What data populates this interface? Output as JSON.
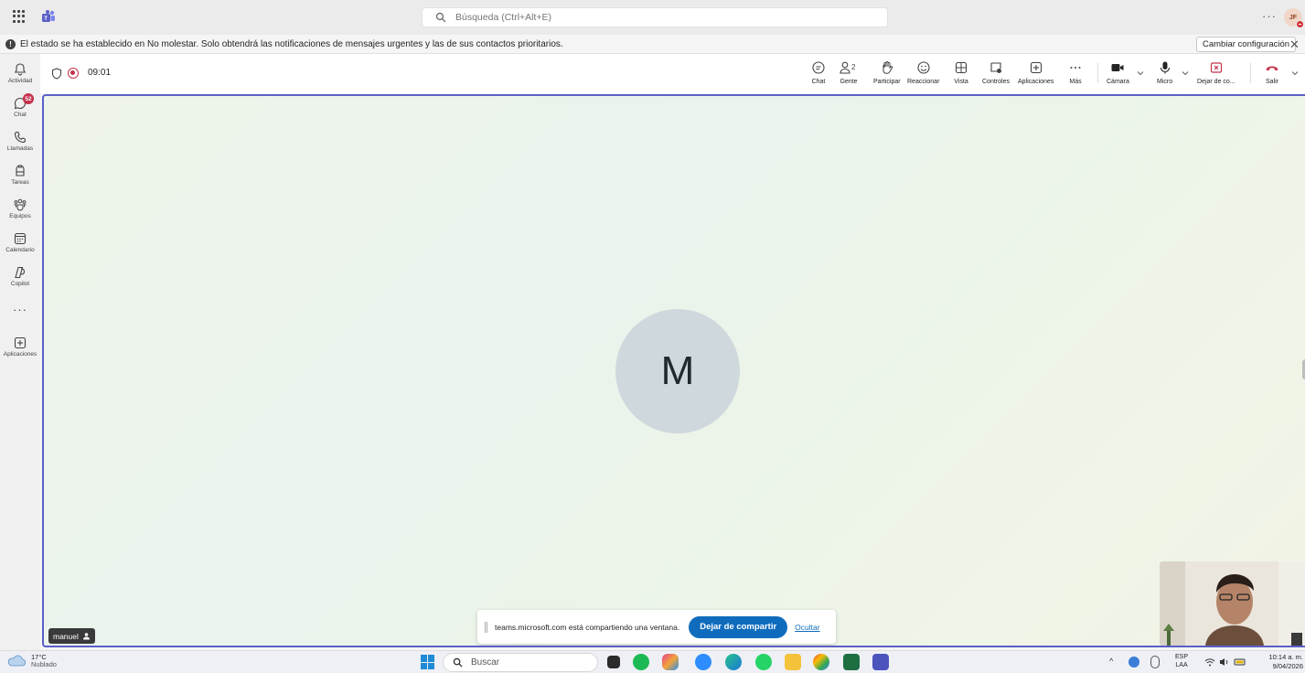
{
  "titlebar": {
    "search_placeholder": "Búsqueda (Ctrl+Alt+E)",
    "more": "···",
    "avatar_initials": "JF"
  },
  "banner": {
    "message": "El estado se ha establecido en No molestar. Solo obtendrá las notificaciones de mensajes urgentes y las de sus contactos prioritarios.",
    "change_button": "Cambiar configuración",
    "close": "✕"
  },
  "rail": {
    "items": [
      {
        "label": "Actividad",
        "icon": "bell-icon"
      },
      {
        "label": "Chat",
        "icon": "chat-icon",
        "badge": "52"
      },
      {
        "label": "Llamadas",
        "icon": "phone-icon"
      },
      {
        "label": "Tareas",
        "icon": "tasks-icon"
      },
      {
        "label": "Equipos",
        "icon": "teams-icon"
      },
      {
        "label": "Calendario",
        "icon": "calendar-icon"
      },
      {
        "label": "Copilot",
        "icon": "copilot-icon"
      },
      {
        "label": "Aplicaciones",
        "icon": "apps-icon"
      }
    ],
    "more": "···"
  },
  "meeting": {
    "timer": "09:01",
    "people_count": "2",
    "toolbar": {
      "chat": "Chat",
      "people": "Gente",
      "raise": "Participar",
      "react": "Reaccionar",
      "view": "Vista",
      "controls": "Controles",
      "apps": "Aplicaciones",
      "more": "Más",
      "camera": "Cámara",
      "mic": "Micro",
      "stop_share": "Dejar de co...",
      "leave": "Salir"
    }
  },
  "stage": {
    "avatar_letter": "M",
    "participant_name": "manuel",
    "share_text": "teams.microsoft.com está compartiendo una ventana.",
    "stop_button": "Dejar de compartir",
    "hide_link": "Ocultar"
  },
  "taskbar": {
    "temp": "17°C",
    "condition": "Nublado",
    "search": "Buscar",
    "lang_line1": "ESP",
    "lang_line2": "LAA",
    "time": "10:14 a. m.",
    "date": "9/04/2026"
  },
  "colors": {
    "accent": "#5b5fc7",
    "primary_button": "#0f6cbd",
    "badge": "#c4314b",
    "leave": "#c4314b"
  }
}
